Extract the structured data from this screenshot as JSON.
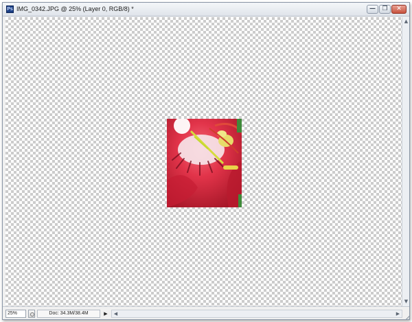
{
  "window": {
    "title": "IMG_0342.JPG @ 25% (Layer 0, RGB/8) *",
    "app_icon": "photoshop-document-icon",
    "controls": {
      "minimize": "—",
      "restore": "❐",
      "close": "✕"
    }
  },
  "canvas": {
    "background": "transparency-checkerboard",
    "image_layer": "Layer 0"
  },
  "scrollbar": {
    "up_arrow": "▲",
    "down_arrow": "▼",
    "left_arrow": "◀",
    "right_arrow": "▶"
  },
  "status": {
    "zoom": "25%",
    "doc_info": "Doc: 34.3M/38.4M",
    "menu_arrow": "▶"
  },
  "colors": {
    "petal_red": "#d8283a",
    "stamen_yellow": "#d6dc3c",
    "checker_gray": "#cccccc"
  }
}
